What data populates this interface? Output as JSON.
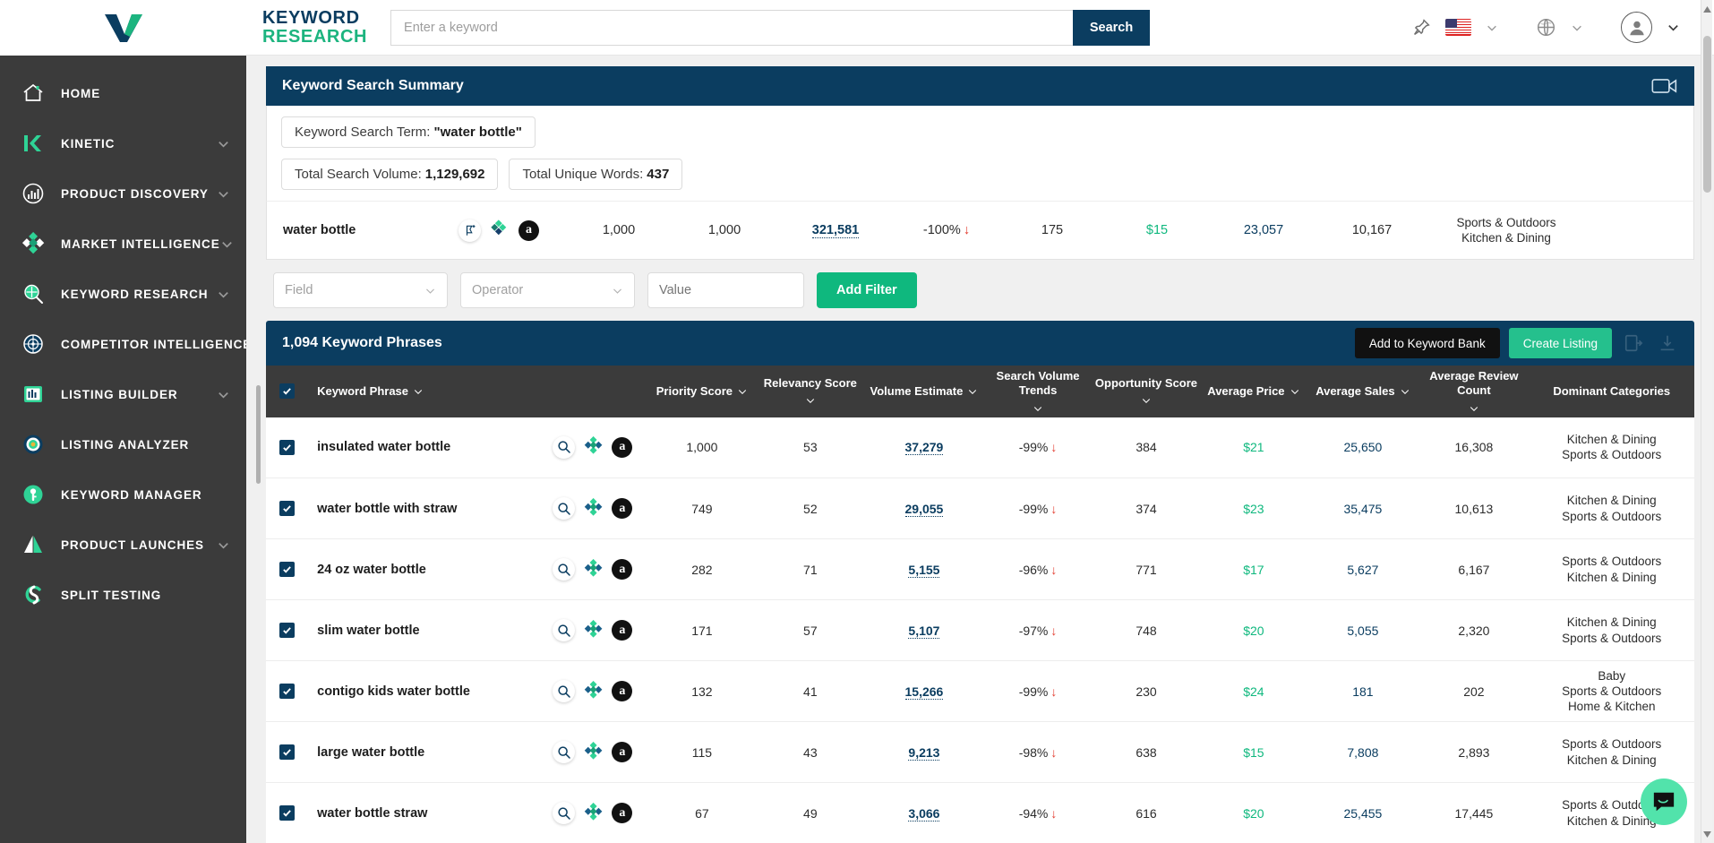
{
  "sidebar": {
    "logo_alt": "viral-launch-checkmark-logo",
    "items": [
      {
        "label": "HOME",
        "icon": "home-icon",
        "expandable": false
      },
      {
        "label": "KINETIC",
        "icon": "kinetic-k-icon",
        "expandable": true
      },
      {
        "label": "PRODUCT DISCOVERY",
        "icon": "product-discovery-icon",
        "expandable": true
      },
      {
        "label": "MARKET INTELLIGENCE",
        "icon": "market-intelligence-icon",
        "expandable": true
      },
      {
        "label": "KEYWORD RESEARCH",
        "icon": "keyword-research-icon",
        "expandable": true
      },
      {
        "label": "COMPETITOR INTELLIGENCE",
        "icon": "competitor-intelligence-icon",
        "expandable": false
      },
      {
        "label": "LISTING BUILDER",
        "icon": "listing-builder-icon",
        "expandable": true
      },
      {
        "label": "LISTING ANALYZER",
        "icon": "listing-analyzer-icon",
        "expandable": false
      },
      {
        "label": "KEYWORD MANAGER",
        "icon": "keyword-manager-icon",
        "expandable": false
      },
      {
        "label": "PRODUCT LAUNCHES",
        "icon": "product-launches-icon",
        "expandable": true
      },
      {
        "label": "SPLIT TESTING",
        "icon": "split-testing-icon",
        "expandable": false
      }
    ]
  },
  "header": {
    "logo_line1": "KEYWORD",
    "logo_line2": "RESEARCH",
    "search_placeholder": "Enter a keyword",
    "search_value": "",
    "search_button": "Search",
    "icons": [
      "pin-icon",
      "us-flag-icon",
      "chevron-down-icon",
      "globe-icon",
      "chevron-down-icon",
      "avatar-icon",
      "chevron-down-icon"
    ]
  },
  "summary": {
    "title": "Keyword Search Summary",
    "video_icon": "video-camera-icon",
    "search_term_label": "Keyword Search Term:",
    "search_term_value": "\"water bottle\"",
    "total_volume_label": "Total Search Volume:",
    "total_volume_value": "1,129,692",
    "unique_words_label": "Total Unique Words:",
    "unique_words_value": "437",
    "row": {
      "keyword": "water bottle",
      "icons": [
        "add-to-keyword-bank-icon",
        "market-intelligence-icon",
        "amazon-icon"
      ],
      "priority_score": "1,000",
      "relevancy_score": "1,000",
      "volume_estimate": "321,581",
      "search_volume_trend": "-100%",
      "trend_direction": "down",
      "opportunity_score": "175",
      "average_price": "$15",
      "average_sales": "23,057",
      "average_review_count": "10,167",
      "dominant_categories": [
        "Sports & Outdoors",
        "Kitchen & Dining"
      ]
    }
  },
  "filters": {
    "field_placeholder": "Field",
    "operator_placeholder": "Operator",
    "value_placeholder": "Value",
    "value": "",
    "add_filter_label": "Add Filter"
  },
  "phrases_panel": {
    "title": "1,094 Keyword Phrases",
    "add_to_bank_label": "Add to Keyword Bank",
    "create_listing_label": "Create Listing",
    "extra_icons": [
      "export-icon",
      "download-icon"
    ]
  },
  "table": {
    "select_all_checked": true,
    "columns": [
      {
        "label": "Keyword Phrase",
        "sortable": true
      },
      {
        "label": "Priority Score",
        "sortable": true
      },
      {
        "label": "Relevancy Score",
        "sortable": true
      },
      {
        "label": "Volume Estimate",
        "sortable": true
      },
      {
        "label": "Search Volume Trends",
        "sortable": true
      },
      {
        "label": "Opportunity Score",
        "sortable": true
      },
      {
        "label": "Average Price",
        "sortable": true
      },
      {
        "label": "Average Sales",
        "sortable": true
      },
      {
        "label": "Average Review Count",
        "sortable": true
      },
      {
        "label": "Dominant Categories",
        "sortable": false
      }
    ],
    "rows": [
      {
        "checked": true,
        "keyword": "insulated water bottle",
        "priority_score": "1,000",
        "relevancy_score": "53",
        "volume_estimate": "37,279",
        "search_volume_trend": "-99%",
        "trend_direction": "down",
        "opportunity_score": "384",
        "average_price": "$21",
        "average_sales": "25,650",
        "average_review_count": "16,308",
        "dominant_categories": [
          "Kitchen & Dining",
          "Sports & Outdoors"
        ]
      },
      {
        "checked": true,
        "keyword": "water bottle with straw",
        "priority_score": "749",
        "relevancy_score": "52",
        "volume_estimate": "29,055",
        "search_volume_trend": "-99%",
        "trend_direction": "down",
        "opportunity_score": "374",
        "average_price": "$23",
        "average_sales": "35,475",
        "average_review_count": "10,613",
        "dominant_categories": [
          "Kitchen & Dining",
          "Sports & Outdoors"
        ]
      },
      {
        "checked": true,
        "keyword": "24 oz water bottle",
        "priority_score": "282",
        "relevancy_score": "71",
        "volume_estimate": "5,155",
        "search_volume_trend": "-96%",
        "trend_direction": "down",
        "opportunity_score": "771",
        "average_price": "$17",
        "average_sales": "5,627",
        "average_review_count": "6,167",
        "dominant_categories": [
          "Sports & Outdoors",
          "Kitchen & Dining"
        ]
      },
      {
        "checked": true,
        "keyword": "slim water bottle",
        "priority_score": "171",
        "relevancy_score": "57",
        "volume_estimate": "5,107",
        "search_volume_trend": "-97%",
        "trend_direction": "down",
        "opportunity_score": "748",
        "average_price": "$20",
        "average_sales": "5,055",
        "average_review_count": "2,320",
        "dominant_categories": [
          "Kitchen & Dining",
          "Sports & Outdoors"
        ]
      },
      {
        "checked": true,
        "keyword": "contigo kids water bottle",
        "priority_score": "132",
        "relevancy_score": "41",
        "volume_estimate": "15,266",
        "search_volume_trend": "-99%",
        "trend_direction": "down",
        "opportunity_score": "230",
        "average_price": "$24",
        "average_sales": "181",
        "average_review_count": "202",
        "dominant_categories": [
          "Baby",
          "Sports & Outdoors",
          "Home & Kitchen"
        ]
      },
      {
        "checked": true,
        "keyword": "large water bottle",
        "priority_score": "115",
        "relevancy_score": "43",
        "volume_estimate": "9,213",
        "search_volume_trend": "-98%",
        "trend_direction": "down",
        "opportunity_score": "638",
        "average_price": "$15",
        "average_sales": "7,808",
        "average_review_count": "2,893",
        "dominant_categories": [
          "Sports & Outdoors",
          "Kitchen & Dining"
        ]
      },
      {
        "checked": true,
        "keyword": "water bottle straw",
        "priority_score": "67",
        "relevancy_score": "49",
        "volume_estimate": "3,066",
        "search_volume_trend": "-94%",
        "trend_direction": "down",
        "opportunity_score": "616",
        "average_price": "$20",
        "average_sales": "25,455",
        "average_review_count": "17,445",
        "dominant_categories": [
          "Sports & Outdoors",
          "Kitchen & Dining"
        ]
      }
    ]
  },
  "chat": {
    "icon": "chat-bubble-icon"
  },
  "colors": {
    "navy": "#0b3d60",
    "green": "#0fb87e",
    "teal": "#25c08d",
    "sidebar": "#3b3b3b",
    "header_row": "#3b3b3b",
    "red": "#e23b2e",
    "chat": "#52e3ab"
  }
}
